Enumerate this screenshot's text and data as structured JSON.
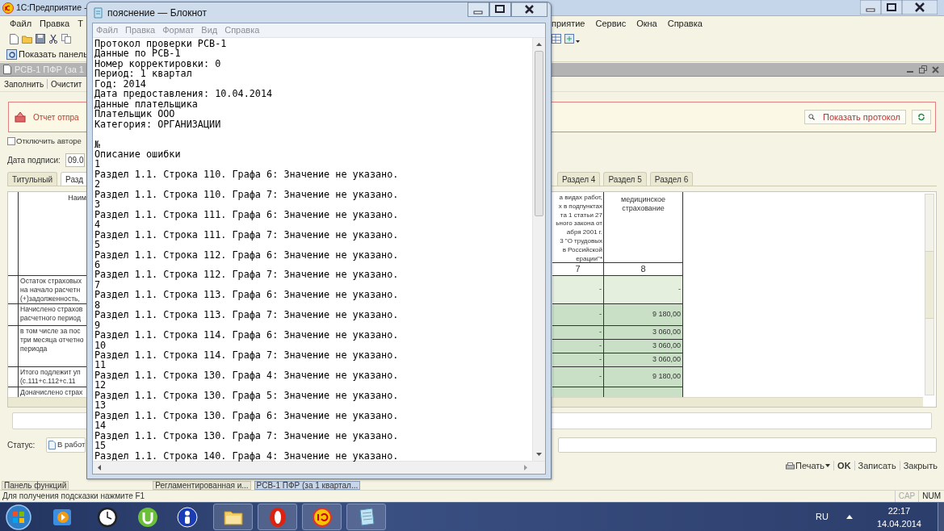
{
  "main_window": {
    "title": "1С:Предприятие -",
    "menu_left": [
      "Файл",
      "Правка",
      "Т"
    ],
    "menu_right": [
      "приятие",
      "Сервис",
      "Окна",
      "Справка"
    ],
    "panel_button": "Показать панель",
    "document": {
      "title": "РСВ-1 ПФР (за 1",
      "commands": [
        "Заполнить",
        "Очистит"
      ],
      "message": {
        "text": "Отчет отпра",
        "button": "Показать протокол"
      },
      "autoreport_checkbox": {
        "label": "Отключить авторе",
        "checked": false
      },
      "signature_date": {
        "label": "Дата подписи:",
        "value": "09.0"
      },
      "tabs_left": [
        {
          "label": "Титульный",
          "selected": false
        },
        {
          "label": "Разд",
          "selected": true
        }
      ],
      "tabs_right": [
        {
          "label": "Раздел 4",
          "selected": false
        },
        {
          "label": "Раздел 5",
          "selected": false
        },
        {
          "label": "Раздел 6",
          "selected": false
        }
      ],
      "table": {
        "left_header": "Наим",
        "right_headers": [
          "а видах работ,\nх в подпунктах\nта 1 статьи 27\nьного закона от\nабря 2001 г.\n3 \"О трудовых\nв Российской\nерации\"*",
          "медицинское\nстрахование"
        ],
        "column_numbers": [
          "7",
          "8"
        ],
        "left_rows": [
          "Остаток страховых\nна начало расчетн\n(+)задолженность,",
          "Начислено страхов\nрасчетного период",
          "в том числе за пос\nтри месяца отчетно\nпериода",
          "Итого подлежит уп\n(с.111+с.112+с.11",
          "Доначислено страх"
        ],
        "right_rows": [
          [
            "-",
            "-"
          ],
          [
            "-",
            "9 180,00"
          ],
          [
            "-",
            "3 060,00"
          ],
          [
            "-",
            "3 060,00"
          ],
          [
            "-",
            "3 060,00"
          ],
          [
            "-",
            "9 180,00"
          ]
        ]
      },
      "status": {
        "label": "Статус:",
        "value": "В работ"
      },
      "buttons": [
        {
          "label": "Печать",
          "kind": "menu"
        },
        {
          "label": "OK",
          "kind": "default"
        },
        {
          "label": "Записать",
          "kind": "plain"
        },
        {
          "label": "Закрыть",
          "kind": "plain"
        }
      ]
    },
    "window_tabs": [
      {
        "label": "Панель функций",
        "selected": false
      },
      {
        "label": "Регламентированная и...",
        "selected": false
      },
      {
        "label": "РСВ-1 ПФР (за 1 квартал...",
        "selected": true
      }
    ],
    "status_bar": {
      "hint": "Для получения подсказки нажмите F1",
      "indicators": [
        {
          "label": "CAP",
          "on": false
        },
        {
          "label": "NUM",
          "on": true
        }
      ]
    }
  },
  "notepad": {
    "title": "пояснение — Блокнот",
    "menu": [
      "Файл",
      "Правка",
      "Формат",
      "Вид",
      "Справка"
    ],
    "header_lines": [
      "Протокол проверки РСВ-1",
      "Данные по РСВ-1",
      "Номер корректировки: 0",
      "Период: 1 квартал",
      "Год: 2014",
      "Дата предоставления: 10.04.2014",
      "Данные плательщика",
      "Плательщик ООО",
      "Категория: ОРГАНИЗАЦИИ"
    ],
    "columns": [
      "№",
      "Описание ошибки"
    ],
    "errors": [
      {
        "number": "1",
        "text": "Раздел 1.1. Строка 110. Графа 6: Значение не указано."
      },
      {
        "number": "2",
        "text": "Раздел 1.1. Строка 110. Графа 7: Значение не указано."
      },
      {
        "number": "3",
        "text": "Раздел 1.1. Строка 111. Графа 6: Значение не указано."
      },
      {
        "number": "4",
        "text": "Раздел 1.1. Строка 111. Графа 7: Значение не указано."
      },
      {
        "number": "5",
        "text": "Раздел 1.1. Строка 112. Графа 6: Значение не указано."
      },
      {
        "number": "6",
        "text": "Раздел 1.1. Строка 112. Графа 7: Значение не указано."
      },
      {
        "number": "7",
        "text": "Раздел 1.1. Строка 113. Графа 6: Значение не указано."
      },
      {
        "number": "8",
        "text": "Раздел 1.1. Строка 113. Графа 7: Значение не указано."
      },
      {
        "number": "9",
        "text": "Раздел 1.1. Строка 114. Графа 6: Значение не указано."
      },
      {
        "number": "10",
        "text": "Раздел 1.1. Строка 114. Графа 7: Значение не указано."
      },
      {
        "number": "11",
        "text": "Раздел 1.1. Строка 130. Графа 4: Значение не указано."
      },
      {
        "number": "12",
        "text": "Раздел 1.1. Строка 130. Графа 5: Значение не указано."
      },
      {
        "number": "13",
        "text": "Раздел 1.1. Строка 130. Графа 6: Значение не указано."
      },
      {
        "number": "14",
        "text": "Раздел 1.1. Строка 130. Графа 7: Значение не указано."
      },
      {
        "number": "15",
        "text": "Раздел 1.1. Строка 140. Графа 4: Значение не указано."
      }
    ]
  },
  "taskbar": {
    "language": "RU",
    "time": "22:17",
    "date": "14.04.2014"
  }
}
